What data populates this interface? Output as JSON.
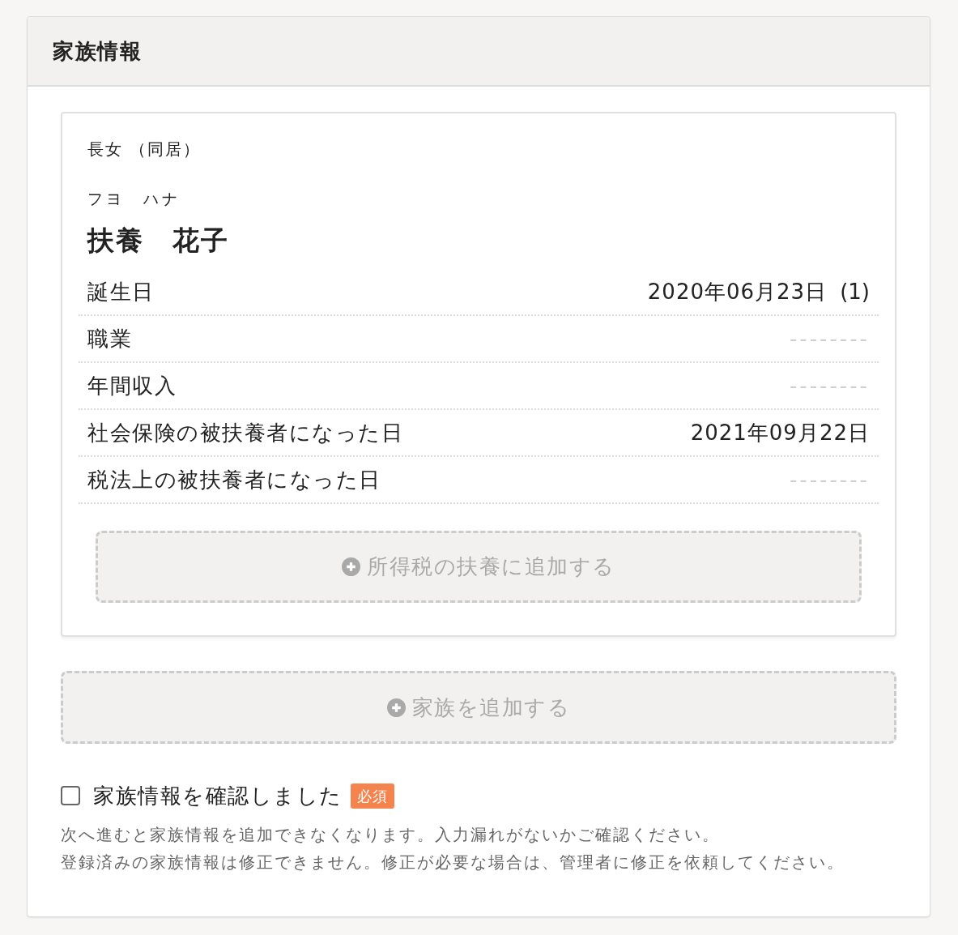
{
  "panel": {
    "title": "家族情報"
  },
  "members": [
    {
      "relation": "長女 （同居）",
      "kana": "フヨ　ハナ",
      "name": "扶養　花子",
      "fields": [
        {
          "label": "誕生日",
          "value": "2020年06月23日",
          "age": "(1)",
          "empty": false
        },
        {
          "label": "職業",
          "value": "--------",
          "empty": true
        },
        {
          "label": "年間収入",
          "value": "--------",
          "empty": true
        },
        {
          "label": "社会保険の被扶養者になった日",
          "value": "2021年09月22日",
          "empty": false
        },
        {
          "label": "税法上の被扶養者になった日",
          "value": "--------",
          "empty": true
        }
      ],
      "add_button": {
        "label": "所得税の扶養に追加する"
      }
    }
  ],
  "add_family_button": {
    "label": "家族を追加する"
  },
  "confirm": {
    "label": "家族情報を確認しました",
    "checked": false,
    "badge": "必須"
  },
  "notes": [
    "次へ進むと家族情報を追加できなくなります。入力漏れがないかご確認ください。",
    "登録済みの家族情報は修正できません。修正が必要な場合は、管理者に修正を依頼してください。"
  ]
}
